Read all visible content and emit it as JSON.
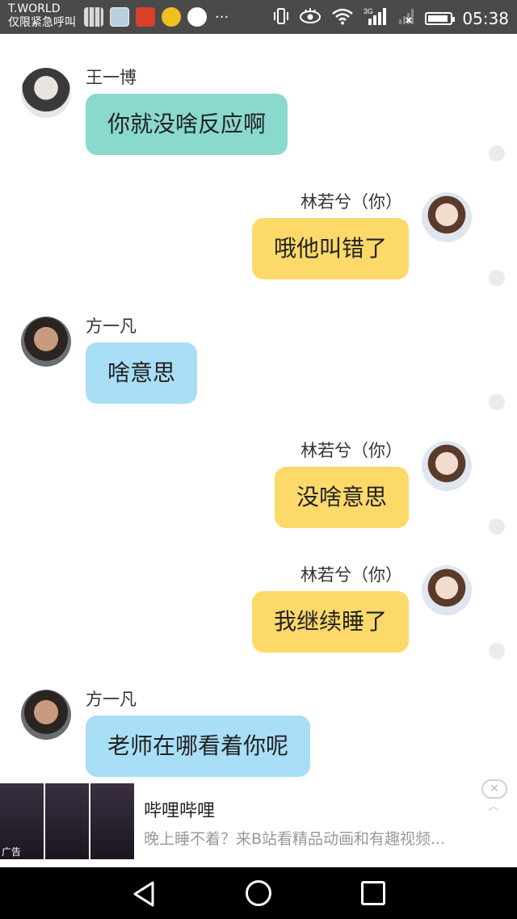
{
  "status_bar": {
    "carrier_top": "T.WORLD",
    "carrier_bottom": "仅限紧急呼叫",
    "more": "···",
    "network": "3G",
    "time": "05:38"
  },
  "messages": [
    {
      "sender": "王一博",
      "text": "你就没啥反应啊"
    },
    {
      "sender": "林若兮（你）",
      "text": "哦他叫错了"
    },
    {
      "sender": "方一凡",
      "text": "啥意思"
    },
    {
      "sender": "林若兮（你）",
      "text": "没啥意思"
    },
    {
      "sender": "林若兮（你）",
      "text": "我继续睡了"
    },
    {
      "sender": "方一凡",
      "text": "老师在哪看着你呢"
    }
  ],
  "ad": {
    "title": "哔哩哔哩",
    "description": "晚上睡不着？来B站看精品动画和有趣视频...",
    "badge": "广告",
    "close": "✕",
    "chevron": "︿"
  },
  "colors": {
    "status_bar": "#4a4a4a",
    "bubble_teal": "#8ad9ce",
    "bubble_blue": "#a9def7",
    "bubble_yellow": "#fdd96a"
  },
  "icons": [
    "vibrate-icon",
    "eye-icon",
    "wifi-icon",
    "signal-icon",
    "battery-icon",
    "back-icon",
    "home-icon",
    "recents-icon"
  ]
}
